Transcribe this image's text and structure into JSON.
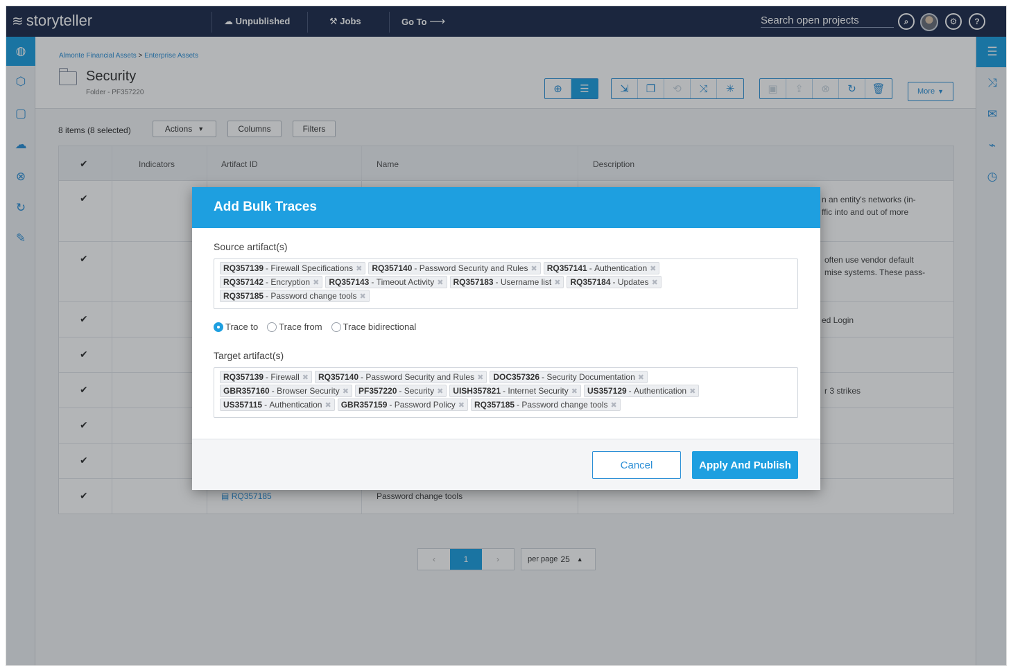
{
  "topbar": {
    "logo": "storyteller",
    "nav": [
      "Unpublished",
      "Jobs",
      "Go To"
    ],
    "search_link": "Search open projects"
  },
  "header": {
    "breadcrumb": [
      "Almonte Financial Assets",
      "Enterprise Assets"
    ],
    "breadcrumb_sep": ">",
    "title": "Security",
    "subtitle": "Folder - PF357220",
    "more_label": "More"
  },
  "list": {
    "items_count": "8 items",
    "selected": "(8 selected)",
    "actions_label": "Actions",
    "columns_label": "Columns",
    "filters_label": "Filters",
    "headers": [
      "Indicators",
      "Artifact ID",
      "Name",
      "Description"
    ],
    "visible_row_id": "RQ357185",
    "visible_row_name": "Password change tools",
    "desc_fragments": [
      "n an entity's networks (in-",
      "ffic into and out of more",
      "often use vendor default",
      "mise systems. These pass-",
      "ed Login",
      "r 3 strikes"
    ]
  },
  "pager": {
    "prev": "‹",
    "current": "1",
    "next": "›",
    "per_page_label": "per page",
    "per_page_value": "25"
  },
  "modal": {
    "title": "Add Bulk Traces",
    "source_label": "Source artifact(s)",
    "source_tags": [
      [
        [
          "RQ357139",
          "Firewall Specifications"
        ],
        [
          "RQ357140",
          "Password Security and Rules"
        ],
        [
          "RQ357141",
          "Authentication"
        ]
      ],
      [
        [
          "RQ357142",
          "Encryption"
        ],
        [
          "RQ357143",
          "Timeout Activity"
        ],
        [
          "RQ357183",
          "Username list"
        ],
        [
          "RQ357184",
          "Updates"
        ]
      ],
      [
        [
          "RQ357185",
          "Password change tools"
        ]
      ]
    ],
    "radios": [
      "Trace to",
      "Trace from",
      "Trace bidirectional"
    ],
    "radio_selected": 0,
    "target_label": "Target artifact(s)",
    "target_tags": [
      [
        [
          "RQ357139",
          "Firewall"
        ],
        [
          "RQ357140",
          "Password Security and Rules"
        ],
        [
          "DOC357326",
          "Security Documentation"
        ]
      ],
      [
        [
          "GBR357160",
          "Browser Security"
        ],
        [
          "PF357220",
          "Security"
        ],
        [
          "UISH357821",
          "Internet Security"
        ],
        [
          "US357129",
          "Authentication"
        ]
      ],
      [
        [
          "US357115",
          "Authentication"
        ],
        [
          "GBR357159",
          "Password Policy"
        ],
        [
          "RQ357185",
          "Password change tools"
        ]
      ]
    ],
    "cancel_label": "Cancel",
    "apply_label": "Apply And Publish"
  },
  "colors": {
    "accent": "#1e9fe0",
    "topbar": "#1f2d4d"
  }
}
